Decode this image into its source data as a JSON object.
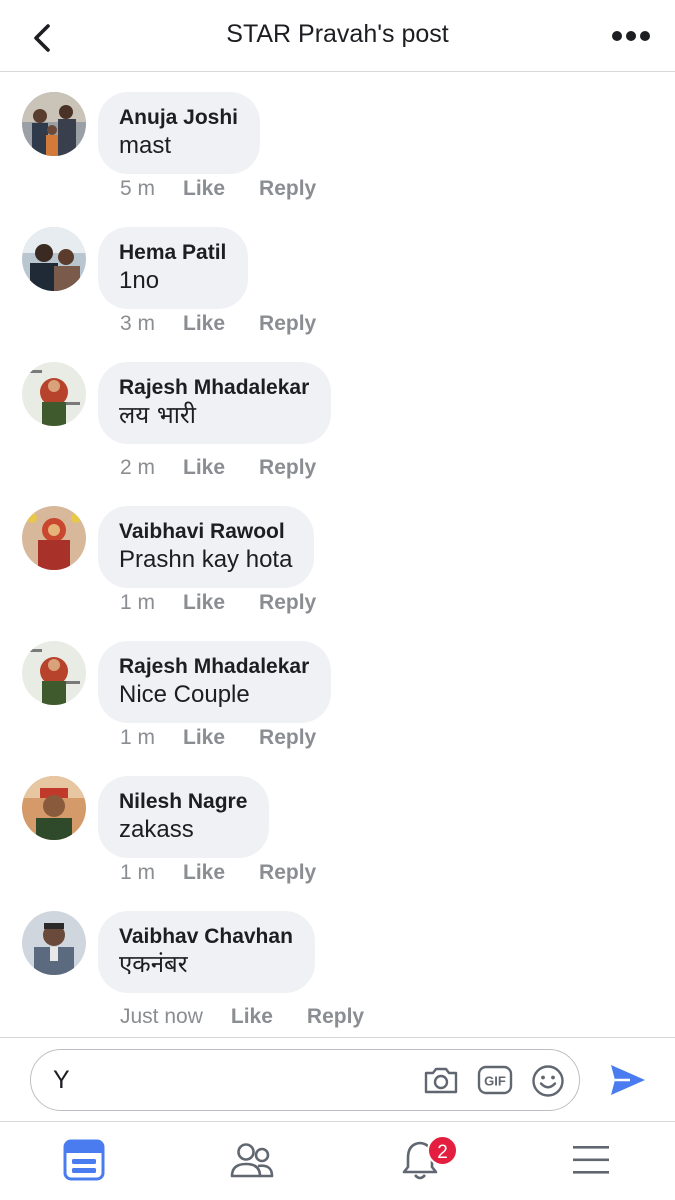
{
  "header": {
    "title": "STAR Pravah's post",
    "back_icon": "chevron-left-icon",
    "more_icon": "more-dots-icon"
  },
  "comments": [
    {
      "author": "Anuja Joshi",
      "text": "mast",
      "time": "5 m",
      "like": "Like",
      "reply": "Reply"
    },
    {
      "author": "Hema Patil",
      "text": "1no",
      "time": "3 m",
      "like": "Like",
      "reply": "Reply"
    },
    {
      "author": "Rajesh Mhadalekar",
      "text": "लय भारी",
      "time": "2 m",
      "like": "Like",
      "reply": "Reply"
    },
    {
      "author": "Vaibhavi Rawool",
      "text": "Prashn kay hota",
      "time": "1 m",
      "like": "Like",
      "reply": "Reply"
    },
    {
      "author": "Rajesh Mhadalekar",
      "text": "Nice Couple",
      "time": "1 m",
      "like": "Like",
      "reply": "Reply"
    },
    {
      "author": "Nilesh Nagre",
      "text": "zakass",
      "time": "1 m",
      "like": "Like",
      "reply": "Reply"
    },
    {
      "author": "Vaibhav Chavhan",
      "text": "एकनंबर",
      "time": "Just now",
      "like": "Like",
      "reply": "Reply"
    }
  ],
  "composer": {
    "value": "Y",
    "icons": [
      "camera-icon",
      "gif-icon",
      "emoji-icon",
      "send-icon"
    ]
  },
  "tabbar": {
    "items": [
      "news-feed-icon",
      "friends-icon",
      "notifications-icon",
      "menu-icon"
    ],
    "notification_count": "2"
  },
  "colors": {
    "accent": "#4a7cf0",
    "bubble": "#f0f1f4",
    "meta": "#8a8d91",
    "badge": "#e41e3f"
  }
}
